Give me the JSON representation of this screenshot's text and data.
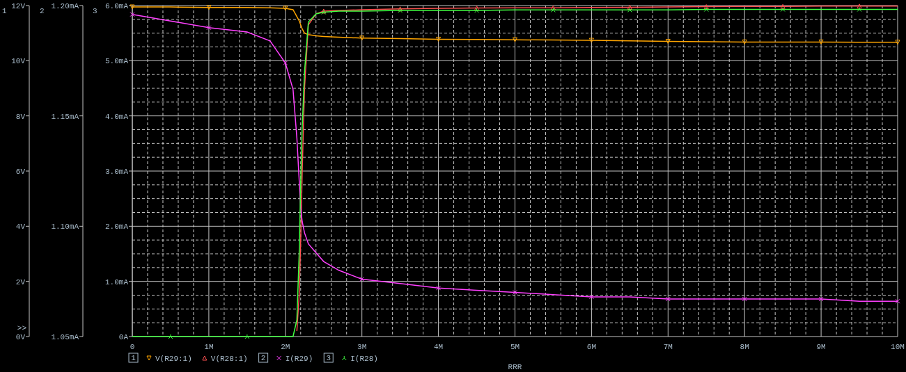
{
  "axes": [
    {
      "number": "1",
      "more": ">>"
    },
    {
      "number": "2"
    },
    {
      "number": "3"
    }
  ],
  "chart_data": {
    "type": "line",
    "xlabel": "RRR",
    "grid": true,
    "legend": "bottom",
    "x": [
      0,
      0.5,
      1,
      1.5,
      1.8,
      2.0,
      2.1,
      2.15,
      2.18,
      2.2,
      2.22,
      2.25,
      2.3,
      2.4,
      2.5,
      2.7,
      3,
      3.5,
      4,
      4.5,
      5,
      5.5,
      6,
      6.5,
      7,
      7.5,
      8,
      8.5,
      9,
      9.5,
      10
    ],
    "xlim": [
      0,
      10
    ],
    "xticks": [
      {
        "value": 0,
        "label": "0"
      },
      {
        "value": 1,
        "label": "1M"
      },
      {
        "value": 2,
        "label": "2M"
      },
      {
        "value": 3,
        "label": "3M"
      },
      {
        "value": 4,
        "label": "4M"
      },
      {
        "value": 5,
        "label": "5M"
      },
      {
        "value": 6,
        "label": "6M"
      },
      {
        "value": 7,
        "label": "7M"
      },
      {
        "value": 8,
        "label": "8M"
      },
      {
        "value": 9,
        "label": "9M"
      },
      {
        "value": 10,
        "label": "10M"
      }
    ],
    "ylim": [
      0,
      6
    ],
    "yticks": [
      {
        "value": 6,
        "label": "6.0mA"
      },
      {
        "value": 5,
        "label": "5.0mA"
      },
      {
        "value": 4,
        "label": "4.0mA"
      },
      {
        "value": 3,
        "label": "3.0mA"
      },
      {
        "value": 2,
        "label": "2.0mA"
      },
      {
        "value": 1,
        "label": "1.0mA"
      },
      {
        "value": 0,
        "label": "0A"
      }
    ],
    "y2lim": [
      0,
      12
    ],
    "y2ticks": [
      {
        "value": 12,
        "label": "12V"
      },
      {
        "value": 10,
        "label": "10V"
      },
      {
        "value": 8,
        "label": "8V"
      },
      {
        "value": 6,
        "label": "6V"
      },
      {
        "value": 4,
        "label": "4V"
      },
      {
        "value": 2,
        "label": "2V"
      },
      {
        "value": 0,
        "label": "0V"
      }
    ],
    "y3lim": [
      1.05,
      1.2
    ],
    "y3ticks": [
      {
        "value": 1.2,
        "label": "1.20mA"
      },
      {
        "value": 1.15,
        "label": "1.15mA"
      },
      {
        "value": 1.1,
        "label": "1.10mA"
      },
      {
        "value": 1.05,
        "label": "1.05mA"
      }
    ],
    "series": [
      {
        "name": "V(R29:1)",
        "color": "#ffa500",
        "axis": "y2",
        "values": [
          11.95,
          11.95,
          11.93,
          11.93,
          11.92,
          11.9,
          11.85,
          11.6,
          11.45,
          11.3,
          11.15,
          11.0,
          10.95,
          10.9,
          10.88,
          10.85,
          10.82,
          10.8,
          10.78,
          10.77,
          10.76,
          10.75,
          10.74,
          10.72,
          10.7,
          10.69,
          10.68,
          10.68,
          10.68,
          10.67,
          10.67
        ]
      },
      {
        "name": "V(R28:1)",
        "color": "#ff5050",
        "axis": "y2",
        "values": [
          null,
          null,
          null,
          null,
          null,
          null,
          null,
          0.2,
          1.5,
          3.5,
          6,
          9,
          11.3,
          11.7,
          11.8,
          11.82,
          11.85,
          11.88,
          11.9,
          11.91,
          11.92,
          11.92,
          11.93,
          11.94,
          11.95,
          11.96,
          11.97,
          11.97,
          11.98,
          11.98,
          11.98
        ]
      },
      {
        "name": "I(R29)",
        "color": "#ff40ff",
        "axis": "y3",
        "values": [
          1.196,
          1.193,
          1.19,
          1.188,
          1.184,
          1.174,
          1.162,
          1.14,
          1.121,
          1.108,
          1.102,
          1.097,
          1.092,
          1.088,
          1.084,
          1.08,
          1.076,
          1.074,
          1.072,
          1.071,
          1.07,
          1.069,
          1.068,
          1.068,
          1.067,
          1.067,
          1.067,
          1.067,
          1.067,
          1.066,
          1.066
        ]
      },
      {
        "name": "I(R28)",
        "color": "#40ff40",
        "values": [
          0,
          0,
          0,
          0,
          0,
          0,
          0,
          0.3,
          1.5,
          2.8,
          3.8,
          4.8,
          5.7,
          5.85,
          5.88,
          5.9,
          5.9,
          5.91,
          5.91,
          5.91,
          5.92,
          5.92,
          5.92,
          5.92,
          5.92,
          5.93,
          5.93,
          5.93,
          5.93,
          5.93,
          5.93
        ]
      }
    ]
  },
  "legend_boxes": [
    "1",
    "2",
    "3"
  ]
}
